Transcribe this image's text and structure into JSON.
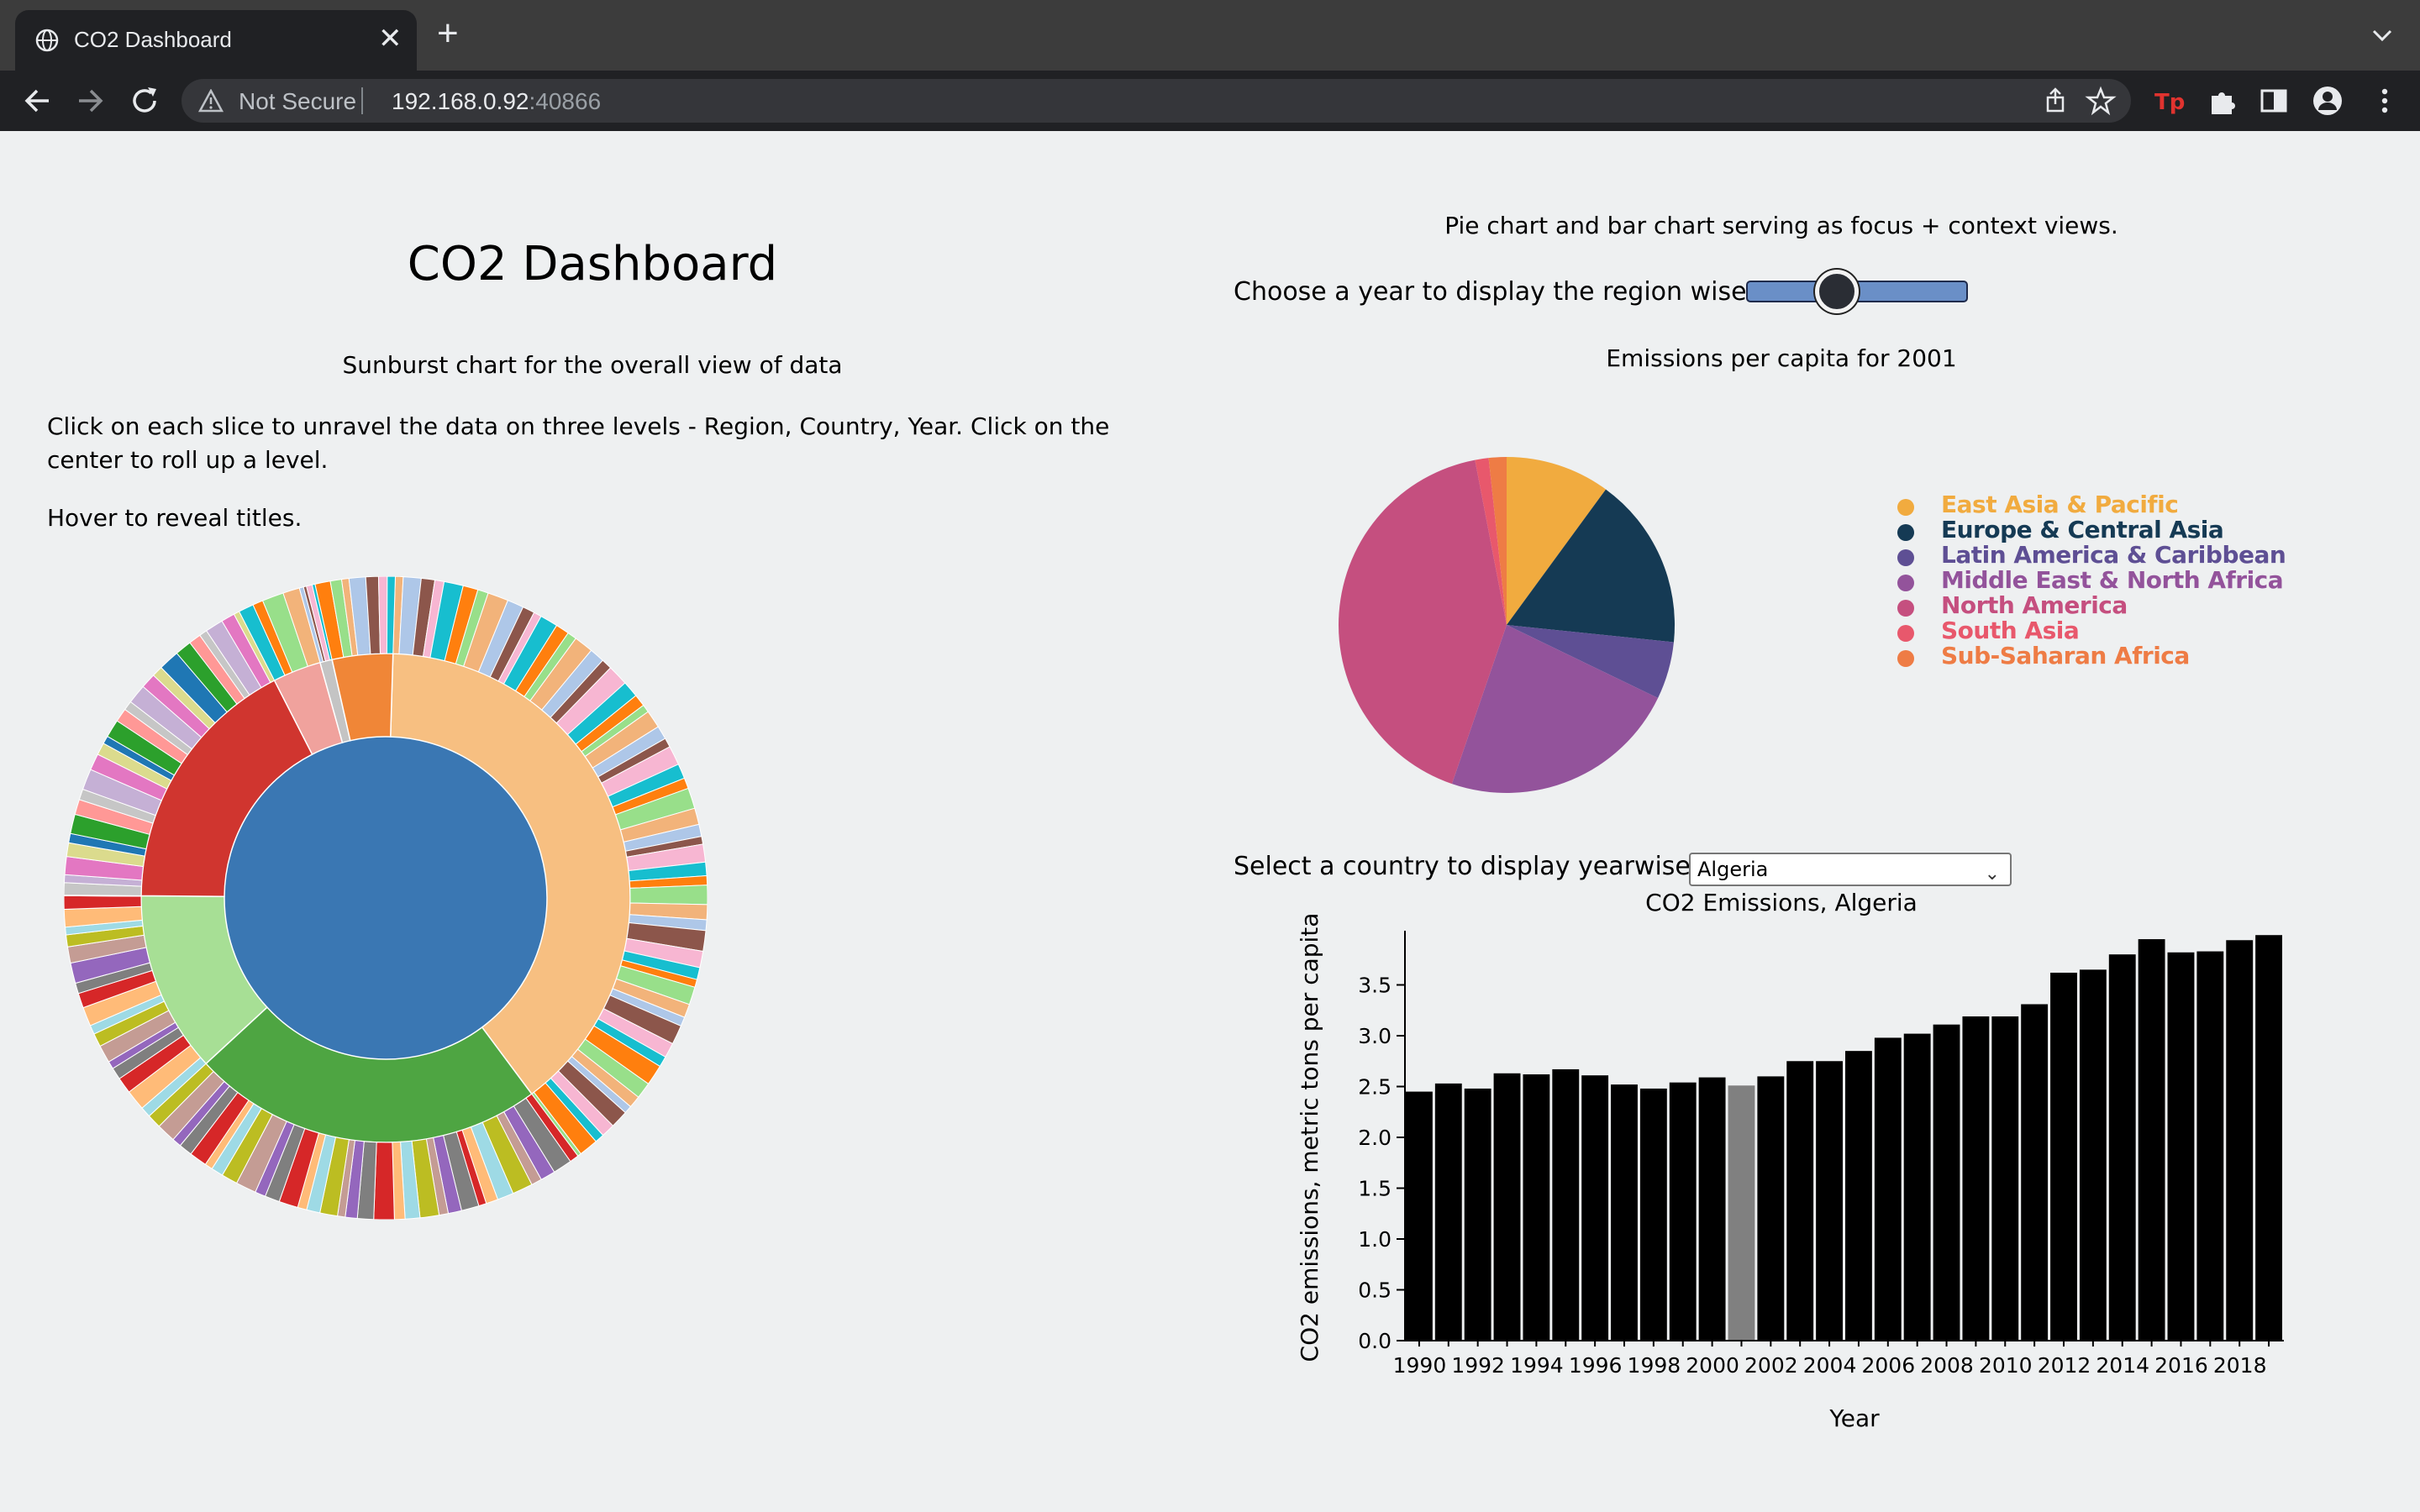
{
  "browser": {
    "tab_title": "CO2 Dashboard",
    "new_tab": "+",
    "close": "✕",
    "security_label": "Not Secure",
    "url_host": "192.168.0.92",
    "url_port": ":40866",
    "icons": [
      "globe-icon",
      "back-icon",
      "forward-icon",
      "reload-icon",
      "warning-icon",
      "share-icon",
      "star-icon",
      "extension-tp-icon",
      "puzzle-icon",
      "sidepanel-icon",
      "profile-icon",
      "menu-icon"
    ]
  },
  "left": {
    "title": "CO2 Dashboard",
    "caption": "Sunburst chart for the overall view of data",
    "instructions": "Click on each slice to unravel the data on three levels - Region, Country, Year. Click on the center to roll up a level.",
    "hover_hint": "Hover to reveal titles.",
    "sunburst": {
      "center_color": "#3a77b3",
      "middle_ring": [
        {
          "color": "#f7bf81",
          "value": 29.5
        },
        {
          "color": "#4ea542",
          "value": 17.5
        },
        {
          "color": "#a7df95",
          "value": 9
        },
        {
          "color": "#d0352f",
          "value": 13
        },
        {
          "color": "#f0a29d",
          "value": 2.4
        },
        {
          "color": "#c4c4c4",
          "value": 0.6
        },
        {
          "color": "#f08637",
          "value": 3
        }
      ],
      "outer_palette": [
        "#f2b37a",
        "#7f7f7f",
        "#c6c6c6",
        "#aec7e8",
        "#9467bd",
        "#c5b0d5",
        "#8c564b",
        "#c49c94",
        "#e377c2",
        "#f7b6d2",
        "#bcbd22",
        "#dbdb8d",
        "#17becf",
        "#9edae5",
        "#1f77b4",
        "#ff7f0e",
        "#ffbb78",
        "#2ca02c",
        "#98df8a",
        "#d62728",
        "#ff9896"
      ]
    }
  },
  "right": {
    "caption": "Pie chart and bar chart serving as focus + context views.",
    "year_label": "Choose a year to display the region wise data:",
    "year_value": 2001,
    "year_range": [
      1990,
      2019
    ],
    "pie_title": "Emissions per capita for 2001",
    "country_label": "Select a country to display yearwise data",
    "country_selected": "Algeria",
    "country_chevron": "⌄",
    "bar_title": "CO2 Emissions, Algeria"
  },
  "chart_data": [
    {
      "type": "pie",
      "title": "Emissions per capita for 2001",
      "categories": [
        "East Asia & Pacific",
        "Europe & Central Asia",
        "Latin America & Caribbean",
        "Middle East & North Africa",
        "North America",
        "South Asia",
        "Sub-Saharan Africa"
      ],
      "values": [
        10,
        16.5,
        5.5,
        23,
        41.5,
        1.3,
        1.7
      ],
      "colors": [
        "#f1ab3f",
        "#153a54",
        "#5e4f94",
        "#93539b",
        "#c54f7f",
        "#e8586c",
        "#ee7c45"
      ],
      "legend_position": "right"
    },
    {
      "type": "bar",
      "title": "CO2 Emissions, Algeria",
      "xlabel": "Year",
      "ylabel": "CO2 emissions, metric tons per capita",
      "categories": [
        "1990",
        "1991",
        "1992",
        "1993",
        "1994",
        "1995",
        "1996",
        "1997",
        "1998",
        "1999",
        "2000",
        "2001",
        "2002",
        "2003",
        "2004",
        "2005",
        "2006",
        "2007",
        "2008",
        "2009",
        "2010",
        "2011",
        "2012",
        "2013",
        "2014",
        "2015",
        "2016",
        "2017",
        "2018",
        "2019"
      ],
      "values": [
        2.45,
        2.53,
        2.48,
        2.63,
        2.62,
        2.67,
        2.61,
        2.52,
        2.48,
        2.54,
        2.59,
        2.51,
        2.6,
        2.75,
        2.75,
        2.85,
        2.98,
        3.02,
        3.11,
        3.19,
        3.19,
        3.31,
        3.62,
        3.65,
        3.8,
        3.95,
        3.82,
        3.83,
        3.94,
        3.99
      ],
      "highlight_category": "2001",
      "colors": {
        "bar": "#000000",
        "highlight": "#808080"
      },
      "x_tick_labels": [
        "1990",
        "1992",
        "1994",
        "1996",
        "1998",
        "2000",
        "2002",
        "2004",
        "2006",
        "2008",
        "2010",
        "2012",
        "2014",
        "2016",
        "2018"
      ],
      "y_ticks": [
        "0.0",
        "0.5",
        "1.0",
        "1.5",
        "2.0",
        "2.5",
        "3.0",
        "3.5"
      ],
      "ylim": [
        0,
        4.0
      ]
    }
  ]
}
